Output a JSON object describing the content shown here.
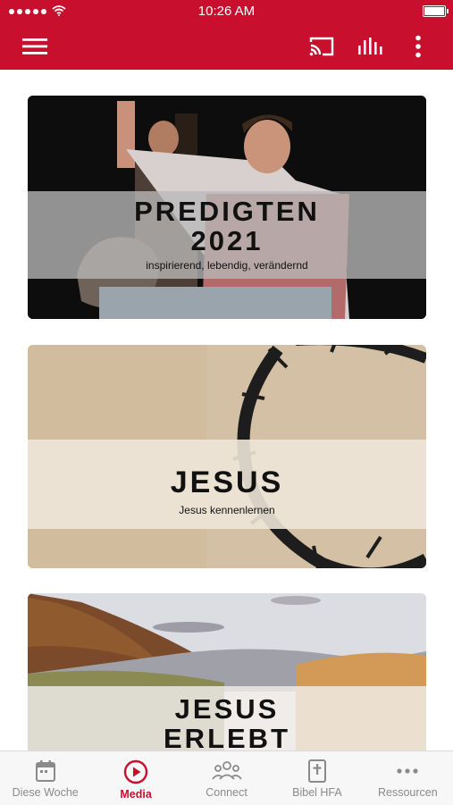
{
  "status_bar": {
    "time": "10:26 AM"
  },
  "cards": [
    {
      "title_line1": "PREDIGTEN",
      "title_line2": "2021",
      "subtitle": "inspirierend, lebendig, verändernd"
    },
    {
      "title_line1": "JESUS",
      "subtitle": "Jesus kennenlernen"
    },
    {
      "title_line1": "JESUS",
      "title_line2": "ERLEBT"
    }
  ],
  "tabs": [
    {
      "label": "Diese Woche",
      "icon": "calendar-icon",
      "active": false
    },
    {
      "label": "Media",
      "icon": "play-circle-icon",
      "active": true
    },
    {
      "label": "Connect",
      "icon": "people-icon",
      "active": false
    },
    {
      "label": "Bibel HFA",
      "icon": "bible-icon",
      "active": false
    },
    {
      "label": "Ressourcen",
      "icon": "more-horizontal-icon",
      "active": false
    }
  ],
  "colors": {
    "brand": "#c8102e",
    "tab_inactive": "#8a8a8a"
  }
}
